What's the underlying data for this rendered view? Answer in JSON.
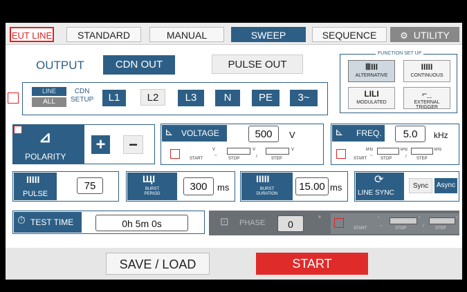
{
  "tabs": {
    "eut_line": "EUT LINE",
    "standard": "STANDARD",
    "manual": "MANUAL",
    "sweep": "SWEEP",
    "sequence": "SEQUENCE",
    "utility": "UTILITY"
  },
  "output": {
    "label": "OUTPUT",
    "cdn_out": "CDN OUT",
    "pulse_out": "PULSE OUT",
    "line": "LINE",
    "all": "ALL",
    "cdn_setup": "CDN\nSETUP",
    "lines": [
      "L1",
      "L2",
      "L3",
      "N",
      "PE",
      "3~"
    ]
  },
  "function_setup": {
    "title": "FUNCTION SET UP",
    "alternative": "ALTERNATIVE",
    "continuous": "CONTINUOUS",
    "modulated": "MODULATED",
    "external_trigger": "EXTERNAL TRIGGER"
  },
  "polarity": {
    "label": "POLARITY",
    "plus": "+",
    "minus": "−"
  },
  "voltage": {
    "label": "VOLTAGE",
    "value": "500",
    "unit": "V",
    "unit_small": "V",
    "start": "START",
    "stop": "STOP",
    "step": "STEP",
    "tilde": "~",
    "slash": "/"
  },
  "freq": {
    "label": "FREQ.",
    "value": "5.0",
    "unit": "kHz",
    "unit_small": "kHz",
    "start": "START",
    "stop": "STOP",
    "step": "STEP",
    "tilde": "~",
    "slash": "/"
  },
  "pulse": {
    "label": "PULSE",
    "value": "75"
  },
  "burst_period": {
    "label": "BURST\nPERIOD",
    "value": "300",
    "unit": "ms"
  },
  "burst_duration": {
    "label": "BURST\nDURATION",
    "value": "15.00",
    "unit": "ms"
  },
  "line_sync": {
    "label": "LINE SYNC",
    "sync": "Sync",
    "async": "Async"
  },
  "test_time": {
    "label": "TEST TIME",
    "value": "0h 5m 0s"
  },
  "phase": {
    "label": "PHASE",
    "value": "0",
    "deg": "°",
    "start": "START",
    "stop": "STOP",
    "step": "STEP",
    "tilde": "~",
    "slash": "/"
  },
  "bottom": {
    "save_load": "SAVE / LOAD",
    "start": "START"
  },
  "colors": {
    "accent": "#2d5f86",
    "alert": "#d22222",
    "start": "#e02b2b"
  }
}
